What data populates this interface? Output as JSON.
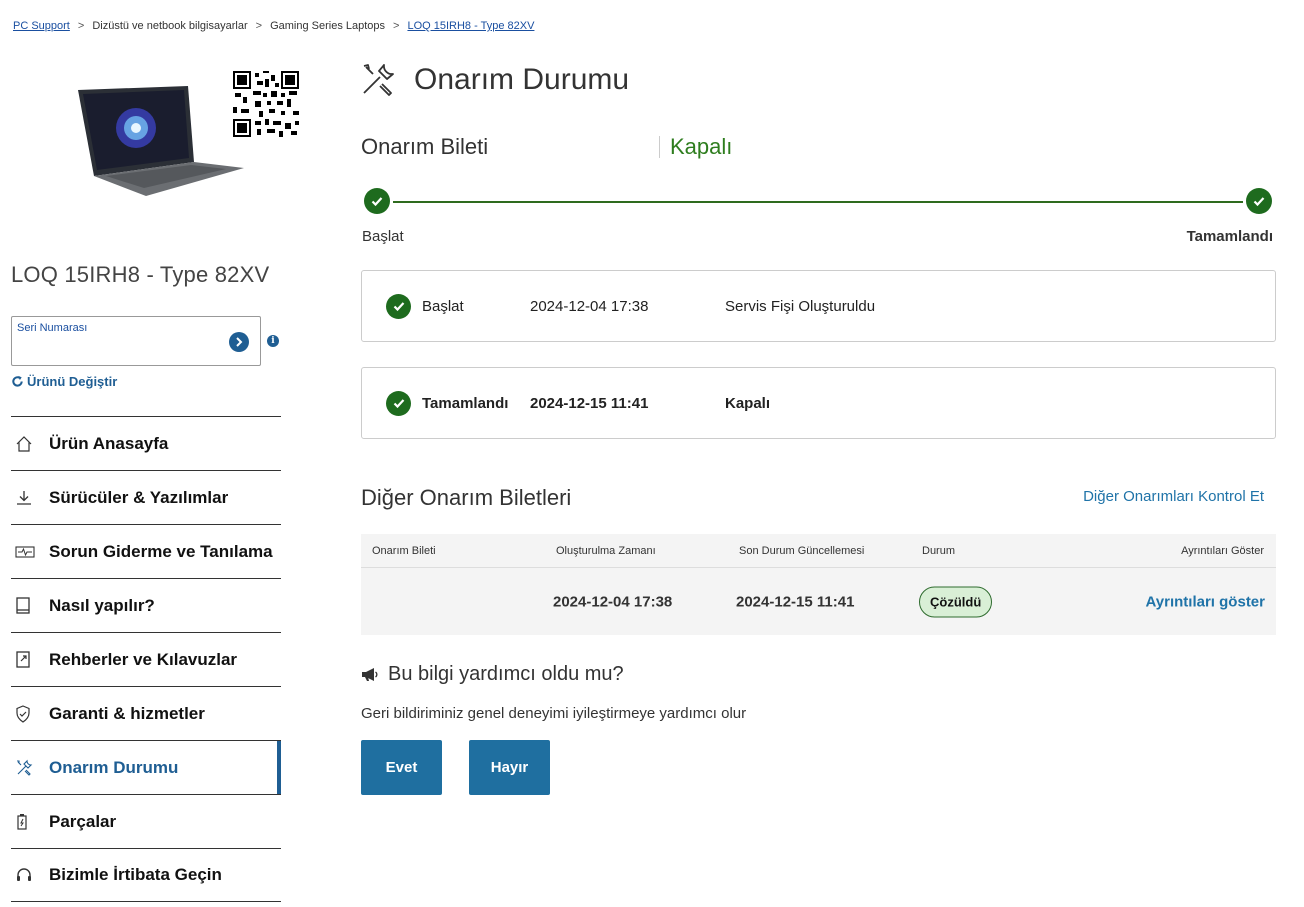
{
  "breadcrumb": {
    "items": [
      "PC Support",
      "Dizüstü ve netbook bilgisayarlar",
      "Gaming Series Laptops",
      "LOQ 15IRH8 - Type 82XV"
    ],
    "separator": ">"
  },
  "product": {
    "title": "LOQ 15IRH8 - Type 82XV",
    "serial_label": "Seri Numarası",
    "serial_value": "",
    "change_product": "Ürünü Değiştir"
  },
  "nav": {
    "items": [
      {
        "label": "Ürün Anasayfa",
        "icon": "home-icon"
      },
      {
        "label": "Sürücüler & Yazılımlar",
        "icon": "download-icon"
      },
      {
        "label": "Sorun Giderme ve Tanılama",
        "icon": "diagnostics-icon"
      },
      {
        "label": "Nasıl yapılır?",
        "icon": "book-icon"
      },
      {
        "label": "Rehberler ve Kılavuzlar",
        "icon": "manual-icon"
      },
      {
        "label": "Garanti & hizmetler",
        "icon": "shield-icon"
      },
      {
        "label": "Onarım Durumu",
        "icon": "tools-icon",
        "active": true
      },
      {
        "label": "Parçalar",
        "icon": "battery-icon"
      },
      {
        "label": "Bizimle İrtibata Geçin",
        "icon": "headset-icon"
      }
    ]
  },
  "main": {
    "title": "Onarım Durumu",
    "ticket_label": "Onarım Bileti",
    "ticket_status": "Kapalı",
    "progress": {
      "start_label": "Başlat",
      "end_label": "Tamamlandı"
    },
    "steps": [
      {
        "name": "Başlat",
        "time": "2024-12-04 17:38",
        "desc": "Servis Fişi Oluşturuldu"
      },
      {
        "name": "Tamamlandı",
        "time": "2024-12-15 11:41",
        "desc": "Kapalı"
      }
    ],
    "other": {
      "title": "Diğer Onarım Biletleri",
      "check_link": "Diğer Onarımları Kontrol Et",
      "columns": [
        "Onarım Bileti",
        "Oluşturulma Zamanı",
        "Son Durum Güncellemesi",
        "Durum",
        "Ayrıntıları Göster"
      ],
      "rows": [
        {
          "ticket": "",
          "created": "2024-12-04 17:38",
          "updated": "2024-12-15 11:41",
          "status": "Çözüldü",
          "details": "Ayrıntıları göster"
        }
      ]
    },
    "feedback": {
      "title": "Bu bilgi yardımcı oldu mu?",
      "subtitle": "Geri bildiriminiz genel deneyimi iyileştirmeye yardımcı olur",
      "yes": "Evet",
      "no": "Hayır"
    }
  },
  "colors": {
    "accent": "#1f5e93",
    "success": "#1e6b1e",
    "button": "#1f6fa0",
    "link": "#1f73a8"
  }
}
